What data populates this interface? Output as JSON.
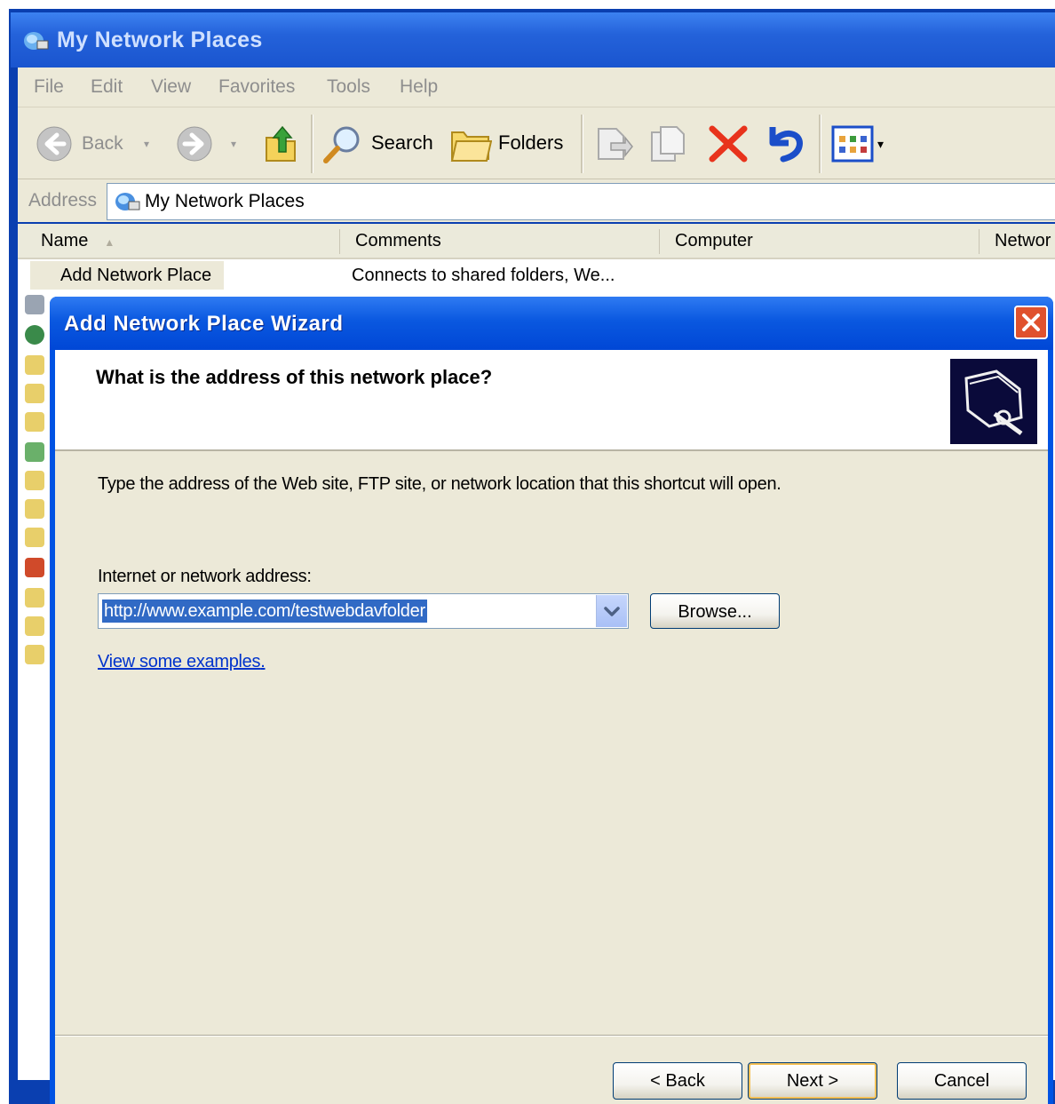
{
  "explorer": {
    "title": "My Network Places",
    "menu": [
      "File",
      "Edit",
      "View",
      "Favorites",
      "Tools",
      "Help"
    ],
    "toolbar": {
      "back_label": "Back",
      "search_label": "Search",
      "folders_label": "Folders"
    },
    "address": {
      "label": "Address",
      "value": "My Network Places"
    },
    "columns": [
      "Name",
      "Comments",
      "Computer",
      "Networ"
    ],
    "rows": [
      {
        "name": "Add Network Place",
        "comment": "Connects to shared folders, We..."
      }
    ]
  },
  "wizard": {
    "title": "Add Network Place Wizard",
    "heading": "What is the address of this network place?",
    "description": "Type the address of the Web site, FTP site, or network location that this shortcut will open.",
    "address_label": "Internet or network address:",
    "address_value": "http://www.example.com/testwebdavfolder",
    "browse_label": "Browse...",
    "examples_link": "View some examples",
    "examples_suffix": ".",
    "back_label": "< Back",
    "next_label": "Next >",
    "cancel_label": "Cancel"
  },
  "colors": {
    "xp_blue": "#0053e3",
    "dialog_face": "#ece9d8",
    "selection": "#316ac5",
    "close_red": "#e0522e"
  },
  "icons": [
    "network-places-icon",
    "back-arrow-icon",
    "forward-arrow-icon",
    "up-folder-icon",
    "search-icon",
    "folders-icon",
    "move-to-icon",
    "copy-to-icon",
    "delete-icon",
    "undo-icon",
    "views-icon",
    "close-icon",
    "wizard-network-folder-icon",
    "dropdown-arrow-icon"
  ]
}
